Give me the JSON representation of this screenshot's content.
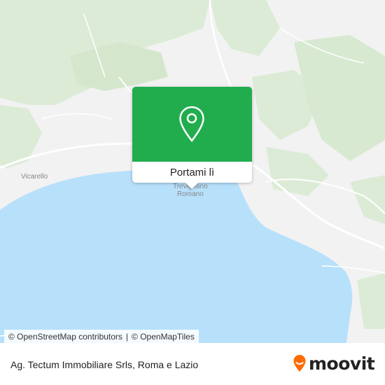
{
  "map": {
    "place_labels": [
      "Vicarello",
      "Trevignano",
      "Romano"
    ],
    "colors": {
      "water": "#b7e0fb",
      "land": "#f2f2f2",
      "vegetation": "#dcebd6",
      "road": "#ffffff"
    }
  },
  "popup": {
    "button_label": "Portami lì",
    "icon": "location-pin-icon",
    "color": "#21ad4e"
  },
  "attribution": {
    "osm_contributors": "© OpenStreetMap contributors",
    "separator": "|",
    "openmaptiles": "© OpenMapTiles"
  },
  "footer": {
    "title": "Ag. Tectum Immobiliare Srls, Roma e Lazio",
    "logo_text": "moovit",
    "logo_color": "#ff6b00"
  }
}
